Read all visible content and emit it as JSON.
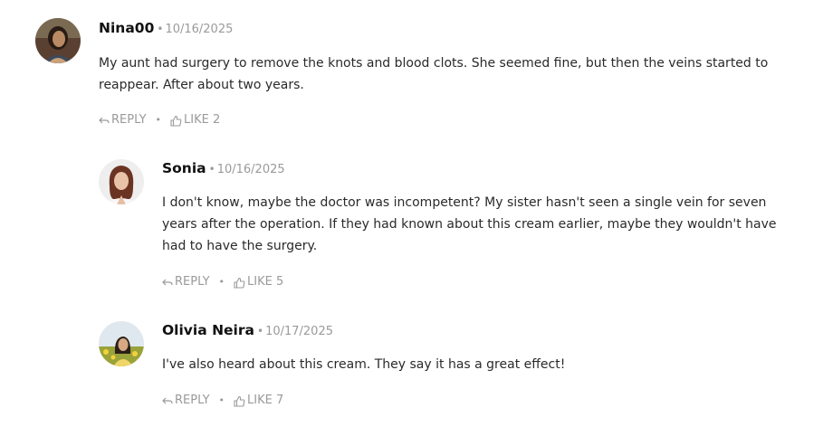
{
  "comments": [
    {
      "author": "Nina00",
      "separator": "•",
      "date": "10/16/2025",
      "text": "My aunt had surgery to remove the knots and blood clots. She seemed fine, but then the veins started to reappear. After about two years.",
      "reply_label": "REPLY",
      "like_label": "LIKE 2",
      "likes": 2
    },
    {
      "author": "Sonia",
      "separator": "•",
      "date": "10/16/2025",
      "text": "I don't know, maybe the doctor was incompetent? My sister hasn't seen a single vein for seven years after the operation. If they had known about this cream earlier, maybe they wouldn't have had to have the surgery.",
      "reply_label": "REPLY",
      "like_label": "LIKE 5",
      "likes": 5
    },
    {
      "author": "Olivia Neira",
      "separator": "•",
      "date": "10/17/2025",
      "text": "I've also heard about this cream. They say it has a great effect!",
      "reply_label": "REPLY",
      "like_label": "LIKE 7",
      "likes": 7
    }
  ],
  "action_separator": "•",
  "colors": {
    "author": "#111111",
    "meta": "#9a9a9a",
    "body": "#2a2a2a"
  },
  "icons": {
    "reply": "reply-arrow-icon",
    "like": "thumbs-up-icon"
  }
}
